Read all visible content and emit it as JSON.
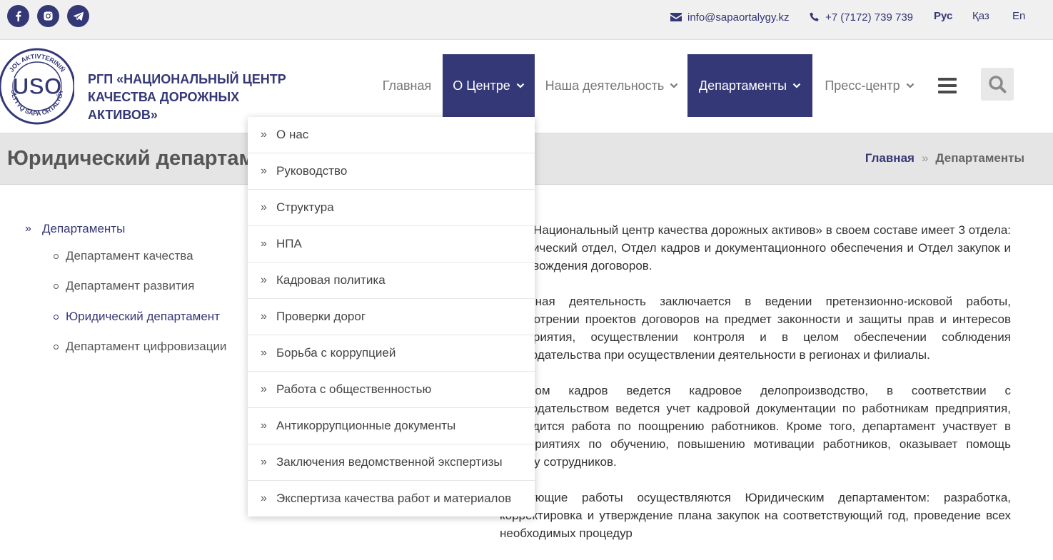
{
  "topbar": {
    "socials": [
      "facebook-icon",
      "instagram-icon",
      "telegram-icon"
    ],
    "email": "info@sapaortalygy.kz",
    "phone": "+7 (7172) 739 739",
    "languages": [
      "Рус",
      "Қаз",
      "En"
    ],
    "active_language": "Рус"
  },
  "header": {
    "brand_line1": "РГП «НАЦИОНАЛЬНЫЙ ЦЕНТР",
    "brand_line2": "КАЧЕСТВА ДОРОЖНЫХ",
    "brand_line3": "АКТИВОВ»",
    "logo_text": "USO",
    "logo_ring_top": "JOL AKTIVTERINIŃ",
    "logo_ring_bottom": "ULTTYQ SAPA ORTALYǴY",
    "nav": [
      {
        "label": "Главная",
        "active": false,
        "dropdown": false
      },
      {
        "label": "О Центре",
        "active": true,
        "dropdown": true
      },
      {
        "label": "Наша деятельность",
        "active": false,
        "dropdown": true
      },
      {
        "label": "Департаменты",
        "active": true,
        "dropdown": true
      },
      {
        "label": "Пресс-центр",
        "active": false,
        "dropdown": true
      }
    ]
  },
  "titlebar": {
    "title": "Юридический департамент",
    "breadcrumb_home": "Главная",
    "breadcrumb_sep": "»",
    "breadcrumb_current": "Департаменты"
  },
  "sidebar": {
    "heading": "Департаменты",
    "items": [
      {
        "label": "Департамент качества",
        "active": false
      },
      {
        "label": "Департамент развития",
        "active": false
      },
      {
        "label": "Юридический департамент",
        "active": true
      },
      {
        "label": "Департамент цифровизации",
        "active": false
      }
    ]
  },
  "content": {
    "p1": "РГП «Национальный центр качества дорожных активов» в своем составе имеет 3 отдела: Юридический отдел, Отдел кадров и документационного обеспечения и Отдел закупок и сопровождения договоров.",
    "p2": "Основная деятельность заключается в ведении претензионно-исковой работы, рассмотрении проектов договоров на предмет законности и защиты прав и интересов предприятия, осуществлении контроля и в целом обеспечении соблюдения законодательства при осуществлении деятельности в регионах и филиалы.",
    "p3": "Отделом кадров ведется кадровое делопроизводство, в соответствии с законодательством ведется учет кадровой документации по работникам предприятия, проводится работа по поощрению работников. Кроме того, департамент участвует в мероприятиях по обучению, повышению мотивации работников, оказывает помощь своему сотрудников.",
    "p4": "Следующие работы осуществляются Юридическим департаментом: разработка, корректировка и утверждение плана закупок на соответствующий год, проведение всех необходимых процедур"
  },
  "dropdown": {
    "items": [
      "О нас",
      "Руководство",
      "Структура",
      "НПА",
      "Кадровая политика",
      "Проверки дорог",
      "Борьба с коррупцией",
      "Работа с общественностью",
      "Антикоррупционные документы",
      "Заключения ведомственной экспертизы",
      "Экспертиза качества работ и материалов"
    ]
  },
  "colors": {
    "brand": "#353876",
    "topbar_bg": "#f0f0f0",
    "titlebar_bg": "#e5e5e5"
  }
}
